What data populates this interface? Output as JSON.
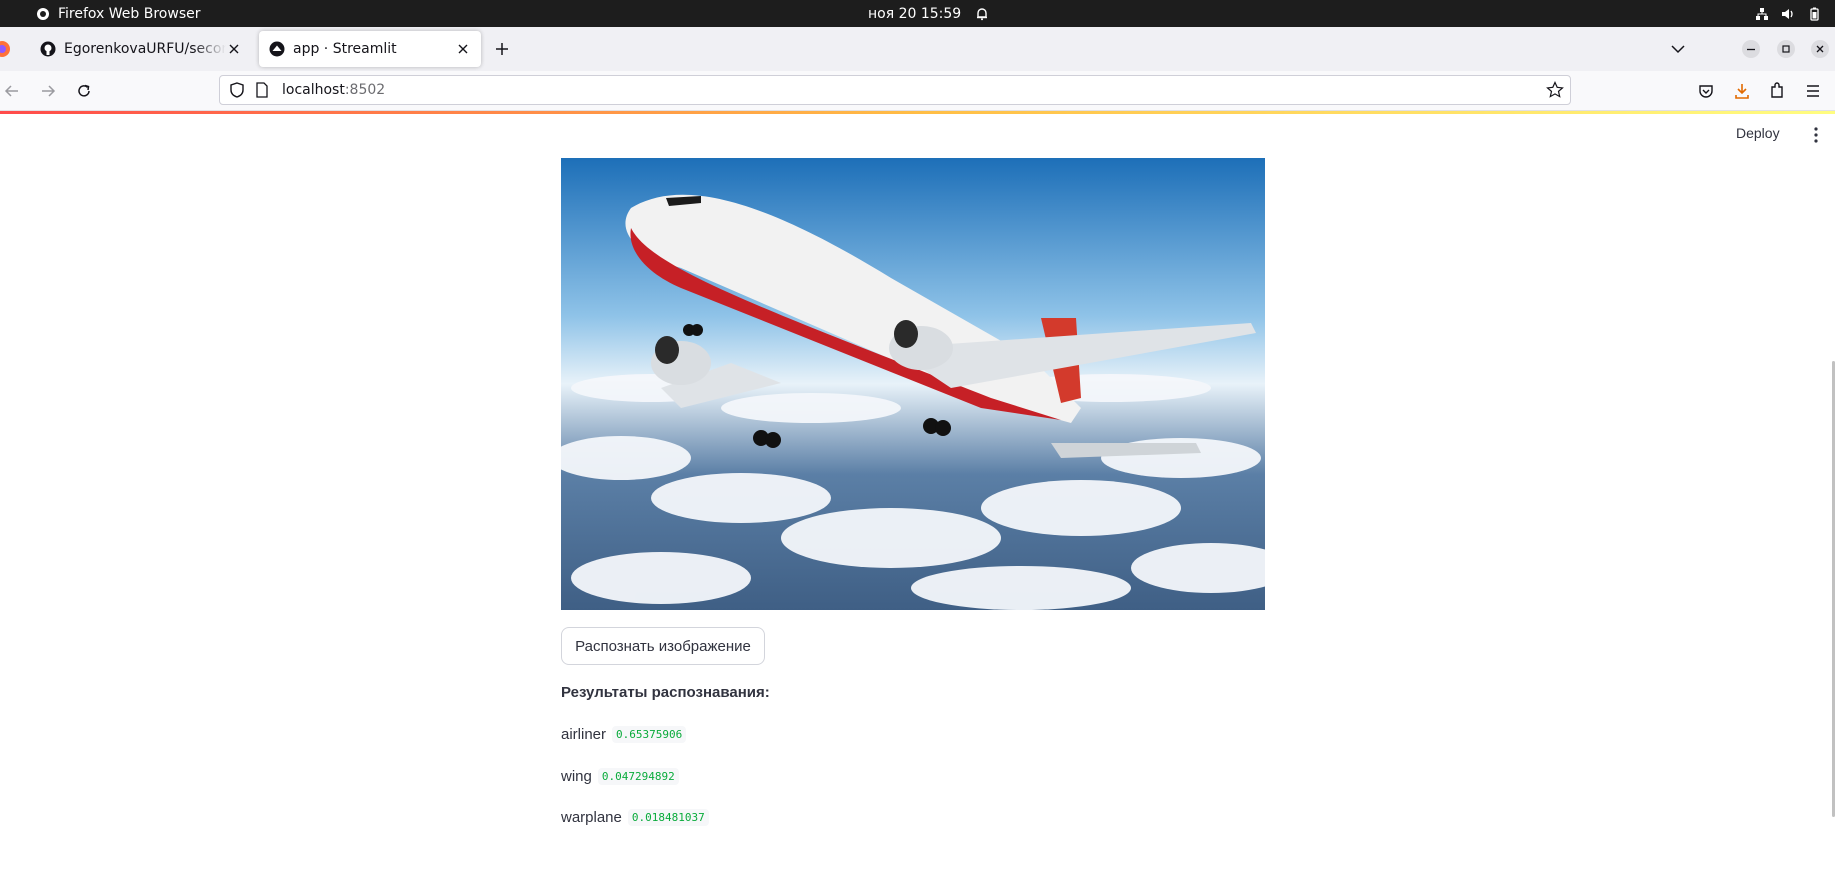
{
  "system": {
    "app_name": "Firefox Web Browser",
    "datetime": "ноя 20  15:59"
  },
  "browser": {
    "tabs": [
      {
        "title": "EgorenkovaURFU/second"
      },
      {
        "title": "app · Streamlit"
      }
    ],
    "url": {
      "host": "localhost",
      "port": ":8502"
    }
  },
  "app": {
    "deploy_label": "Deploy",
    "button_label": "Распознать изображение",
    "results_title": "Результаты распознавания:",
    "results": [
      {
        "label": "airliner",
        "score": "0.65375906"
      },
      {
        "label": "wing",
        "score": "0.047294892"
      },
      {
        "label": "warplane",
        "score": "0.018481037"
      }
    ]
  },
  "colors": {
    "primary": "#ff4b4b",
    "score_text": "#09ab3b",
    "text": "#31333f"
  }
}
